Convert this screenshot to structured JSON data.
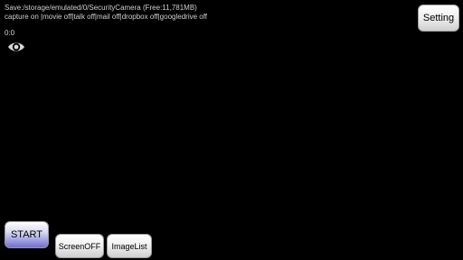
{
  "status": {
    "save_line": "Save:/storage/emulated/0/SecurityCamera  (Free:11,781MB)",
    "capture_line": "capture on |movie off|talk off|mail off|dropbox off|googledrive off",
    "counter": "0:0"
  },
  "buttons": {
    "setting": "Setting",
    "start": "START",
    "screen_off": "ScreenOFF",
    "image_list": "ImageList"
  },
  "icons": {
    "preview": "eye-icon"
  },
  "colors": {
    "background": "#000000",
    "status_text": "#cfcfcf",
    "start_accent": "#6f6fd4"
  }
}
